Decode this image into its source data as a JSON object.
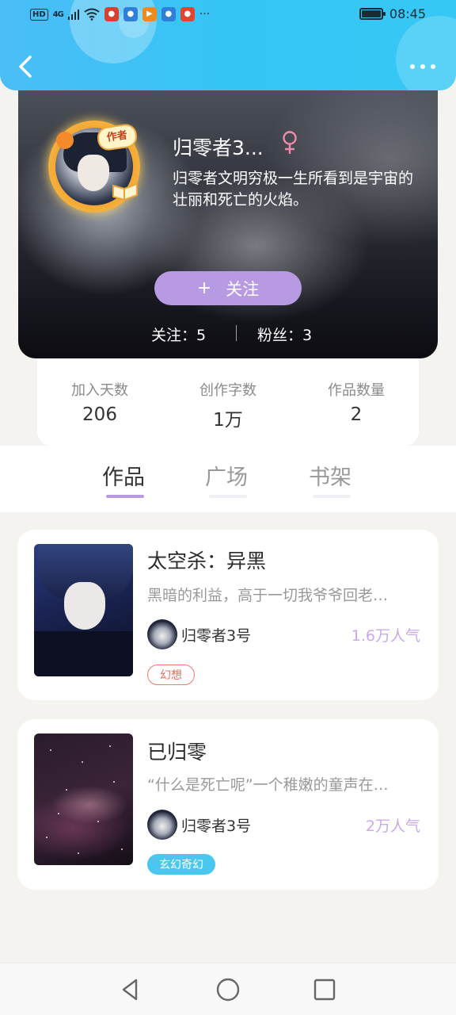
{
  "status_bar": {
    "network": "HD",
    "signal": "4G",
    "time": "08:45"
  },
  "profile": {
    "name": "归零者3...",
    "gender": "female",
    "author_badge": "作者",
    "bio": "归零者文明穷极一生所看到是宇宙的壮丽和死亡的火焰。",
    "follow_button": {
      "plus": "+",
      "label": "关注"
    },
    "following_label": "关注：5",
    "followers_label": "粉丝：3"
  },
  "stats": [
    {
      "label": "加入天数",
      "value": "206"
    },
    {
      "label": "创作字数",
      "value": "1万"
    },
    {
      "label": "作品数量",
      "value": "2"
    }
  ],
  "tabs": [
    {
      "label": "作品",
      "active": true
    },
    {
      "label": "广场",
      "active": false
    },
    {
      "label": "书架",
      "active": false
    }
  ],
  "books": [
    {
      "title": "太空杀：异黑",
      "description": "黑暗的利益，高于一切我爷爷回老…",
      "author": "归零者3号",
      "popularity": "1.6万人气",
      "tag": "幻想"
    },
    {
      "title": "已归零",
      "description": "“什么是死亡呢”一个稚嫩的童声在…",
      "author": "归零者3号",
      "popularity": "2万人气",
      "tag": "玄幻奇幻"
    }
  ],
  "colors": {
    "header_blue": "#36c8f5",
    "accent_purple": "#b79ae2",
    "popularity_purple": "#c9a8ec",
    "tag_red": "#f07a6a",
    "tag_blue": "#4ac7ee"
  }
}
